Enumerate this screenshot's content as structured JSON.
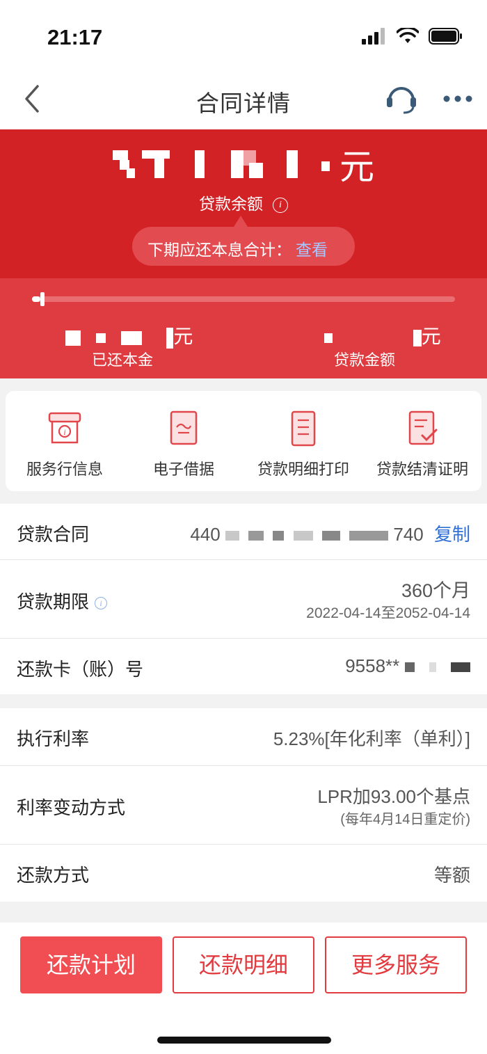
{
  "status": {
    "time": "21:17"
  },
  "nav": {
    "title": "合同详情"
  },
  "hero": {
    "amount_suffix": "元",
    "balance_label": "贷款余额",
    "tooltip_text": "下期应还本息合计：",
    "tooltip_link": "查看",
    "repaid_suffix": "元",
    "repaid_label": "已还本金",
    "loan_suffix": "元",
    "loan_label": "贷款金额",
    "progress_fraction": 0.02
  },
  "shortcuts": [
    {
      "label": "服务行信息",
      "icon": "shop-info-icon"
    },
    {
      "label": "电子借据",
      "icon": "e-receipt-icon"
    },
    {
      "label": "贷款明细打印",
      "icon": "print-detail-icon"
    },
    {
      "label": "贷款结清证明",
      "icon": "settlement-cert-icon"
    }
  ],
  "details": {
    "contract_label": "贷款合同",
    "contract_prefix": "440",
    "contract_suffix": "740",
    "copy_label": "复制",
    "term_label": "贷款期限",
    "term_value": "360个月",
    "term_range": "2022-04-14至2052-04-14",
    "card_label": "还款卡（账）号",
    "card_value": "9558**",
    "rate_label": "执行利率",
    "rate_value": "5.23%[年化利率（单利）]",
    "rate_change_label": "利率变动方式",
    "rate_change_value": "LPR加93.00个基点",
    "rate_change_sub": "(每年4月14日重定价)",
    "repay_method_label": "还款方式",
    "repay_method_value": "等额"
  },
  "buttons": {
    "plan": "还款计划",
    "detail": "还款明细",
    "more": "更多服务"
  },
  "colors": {
    "brand_red": "#d22226",
    "link_blue": "#2f6fd6"
  }
}
